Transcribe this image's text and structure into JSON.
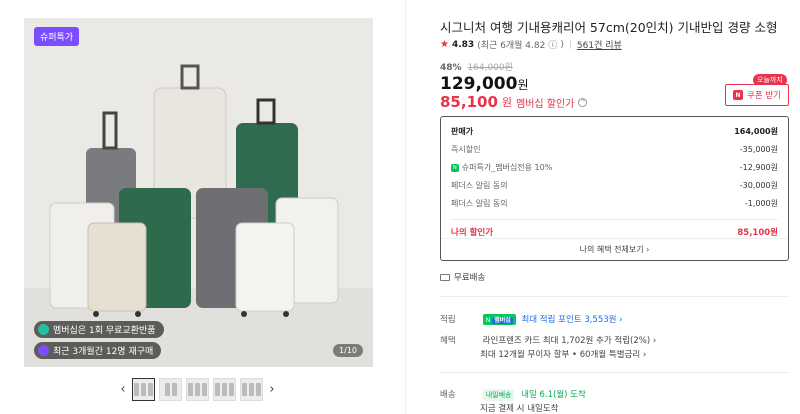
{
  "gallery": {
    "top_badge": "슈퍼특가",
    "pill_1": "멤버십은 1회 무료교환반품",
    "pill_2": "최근 3개월간 12명 재구매",
    "counter": "1/10",
    "prev": "‹",
    "next": "›"
  },
  "product": {
    "title": "시그니처 여행 기내용캐리어 57cm(20인치) 기내반입 경량 소형",
    "rating": "4.83",
    "rating_sub": "(최근 6개월 4.82",
    "rating_sub_close": ")",
    "reviews": "561건 리뷰",
    "discount_pct": "48%",
    "original_price": "164,000원",
    "price": "129,000",
    "price_unit": "원",
    "member_price": "85,100",
    "member_price_unit": "원",
    "member_label": "멤버십 할인가",
    "today_badge": "오늘까지",
    "coupon_label": "쿠폰 받기"
  },
  "price_box": {
    "rows": [
      {
        "label": "판매가",
        "value": "164,000원"
      },
      {
        "label": "즉시할인",
        "value": "-35,000원"
      },
      {
        "label": "슈퍼특가_멤버십전용 10%",
        "value": "-12,900원"
      },
      {
        "label": "페더스 알림 동의",
        "value": "-30,000원"
      },
      {
        "label": "페더스 알림 동의",
        "value": "-1,000원"
      }
    ],
    "nbadge": "N",
    "total_label": "나의 할인가",
    "total_value": "85,100원",
    "footer": "나의 혜택 전체보기 ›"
  },
  "shipping": {
    "free": "무료배송"
  },
  "points": {
    "key": "적립",
    "badge": "N",
    "badge_member": "멤버십",
    "text": "최대 적립 포인트 3,553원 ›"
  },
  "benefits": {
    "key": "혜택",
    "line1": "라인프렌즈 카드 최대 1,702원 추가 적립(2%) ›",
    "line2": "최대 12개월 무이자 할부 • 60개월 특별금리 ›"
  },
  "delivery": {
    "key": "배송",
    "badge": "내일배송",
    "date": "내일 6.1(월) 도착",
    "sub": "지금 결제 시 내일도착"
  }
}
